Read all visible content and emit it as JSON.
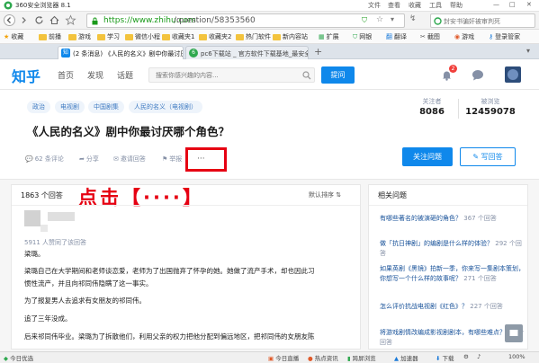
{
  "window": {
    "title": "360安全浏览器 8.1",
    "controls": [
      "文件",
      "查看",
      "收藏",
      "工具",
      "帮助"
    ]
  },
  "address_bar": {
    "url_host": "https://www.zhihu.com",
    "url_path": "/question/58353560",
    "search_placeholder": "封安书骗奸被审判死"
  },
  "bookmarks": [
    {
      "label": "收藏"
    },
    {
      "label": "前播"
    },
    {
      "label": "游戏"
    },
    {
      "label": "学习"
    },
    {
      "label": "微信小程"
    },
    {
      "label": "收藏夹1"
    },
    {
      "label": "收藏夹2"
    },
    {
      "label": "热门软件"
    },
    {
      "label": "新内容站"
    }
  ],
  "bookmarks_right": [
    "扩展",
    "网银",
    "翻译",
    "截图",
    "游戏",
    "登录管家"
  ],
  "tabs": [
    {
      "label": "(2 条消息) 《人民的名义》剧中你最讨厌哪",
      "active": true
    },
    {
      "label": "pc6下载站 _ 官方软件下载基地_最安全",
      "active": false
    }
  ],
  "zhihu": {
    "logo": "知乎",
    "nav": [
      "首页",
      "发现",
      "话题"
    ],
    "search_placeholder": "搜索你感兴趣的内容...",
    "ask_button": "提问",
    "notif_count": "2"
  },
  "question": {
    "tags": [
      "政治",
      "电视剧",
      "中国剧集",
      "人民的名义（电视剧）"
    ],
    "followers_label": "关注者",
    "followers": "8086",
    "views_label": "被浏览",
    "views": "12459078",
    "title": "《人民的名义》剧中你最讨厌哪个角色？",
    "actions": {
      "comments": "62 条评论",
      "share": "分享",
      "invite": "邀请回答",
      "report": "举报",
      "more": "···"
    },
    "follow_button": "关注问题",
    "write_button": "写回答"
  },
  "answers": {
    "count": "1863 个回答",
    "sort": "默认排序",
    "annotation": "点击【····】",
    "upvote_note": "5911 人赞同了该回答",
    "paragraphs": [
      "梁璐。",
      "梁璐自己在大学期间和老师谈恋爱，老师为了出国抛弃了怀孕的她。她做了流产手术，却也因此习",
      "惯性流产，并且向祁同伟隐瞒了这一事实。",
      "为了报复男人去追求有女朋友的祁同伟。",
      "追了三年没成。",
      "后来祁同伟毕业。梁璐为了拆散他们，利用父亲的权力把他分配到偏远地区，把祁同伟的女朋友陈"
    ]
  },
  "related": {
    "title": "相关问题",
    "items": [
      {
        "text": "有哪些著名的被演砸的角色？",
        "count": "367 个回答"
      },
      {
        "text": "做「抗日神剧」的编剧是什么样的体验？",
        "count": "292 个回答"
      },
      {
        "text": "如果英剧《黑镜》拍新一季，你来写一集剧本策划，你想写一个什么样的故事呢？",
        "count": "271 个回答"
      },
      {
        "text": "怎么评价抗战电视剧《红色》？",
        "count": "227 个回答"
      },
      {
        "text": "将游戏剧情改编成影视剧剧本，有哪些难点？",
        "count": "10 个回答"
      }
    ]
  },
  "status_bar": {
    "left": "今日优选",
    "items": [
      "今日直播",
      "热点资讯",
      "跨屏浏览",
      "加速器",
      "下载",
      "100%"
    ]
  }
}
